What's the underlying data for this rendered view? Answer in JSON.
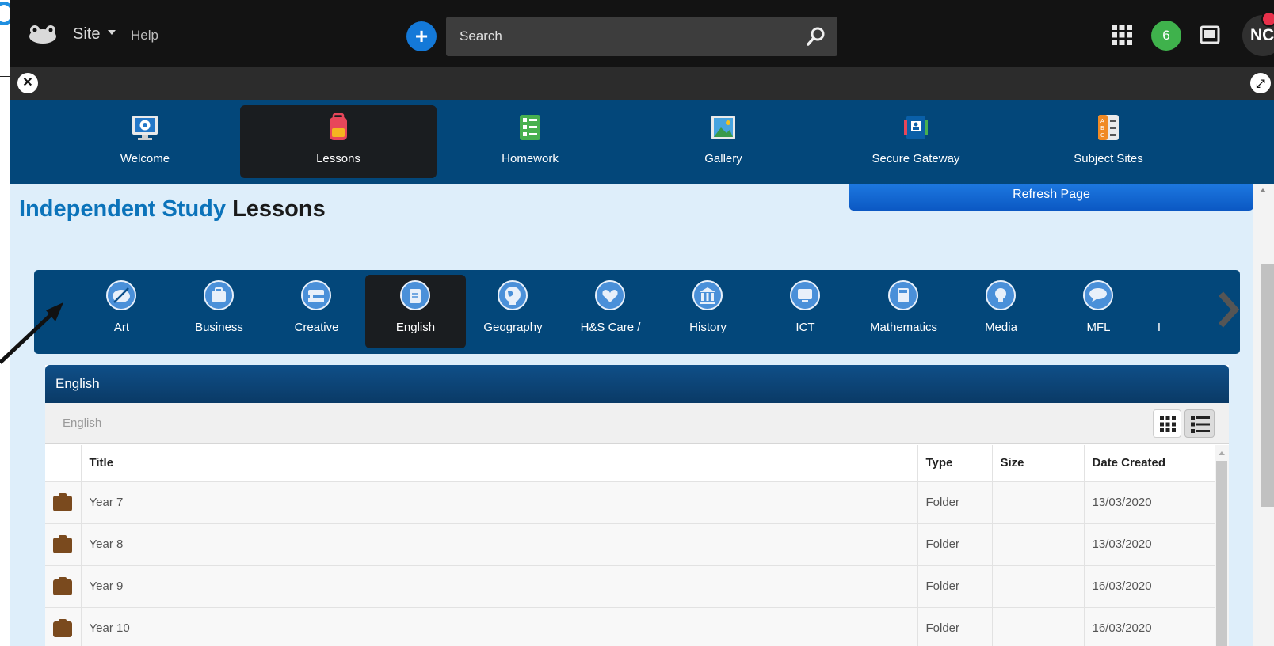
{
  "topbar": {
    "site_label": "Site",
    "help_label": "Help",
    "search_placeholder": "Search",
    "notification_count": "6",
    "user_initials": "NC"
  },
  "appnav": {
    "items": [
      {
        "label": "Welcome",
        "icon": "monitor-lifebuoy-icon",
        "active": false
      },
      {
        "label": "Lessons",
        "icon": "backpack-icon",
        "active": true
      },
      {
        "label": "Homework",
        "icon": "checklist-icon",
        "active": false
      },
      {
        "label": "Gallery",
        "icon": "picture-icon",
        "active": false
      },
      {
        "label": "Secure Gateway",
        "icon": "id-badge-icon",
        "active": false
      },
      {
        "label": "Subject Sites",
        "icon": "abc-list-icon",
        "active": false
      }
    ]
  },
  "page": {
    "title_accent": "Independent Study",
    "title_rest": "Lessons",
    "refresh_label": "Refresh Page"
  },
  "subjects": {
    "items": [
      {
        "label": "Art",
        "icon": "palette-icon",
        "active": false
      },
      {
        "label": "Business",
        "icon": "briefcase-icon",
        "active": false
      },
      {
        "label": "Creative",
        "icon": "sewing-machine-icon",
        "active": false
      },
      {
        "label": "English",
        "icon": "quill-icon",
        "active": true
      },
      {
        "label": "Geography",
        "icon": "globe-icon",
        "active": false
      },
      {
        "label": "H&S Care /",
        "icon": "heart-hands-icon",
        "active": false
      },
      {
        "label": "History",
        "icon": "museum-icon",
        "active": false
      },
      {
        "label": "ICT",
        "icon": "computer-icon",
        "active": false
      },
      {
        "label": "Mathematics",
        "icon": "calculator-icon",
        "active": false
      },
      {
        "label": "Media",
        "icon": "lightbulb-icon",
        "active": false
      },
      {
        "label": "MFL",
        "icon": "speech-bubble-icon",
        "active": false
      },
      {
        "label": "I",
        "icon": "",
        "active": false
      }
    ]
  },
  "panel": {
    "header": "English",
    "breadcrumb": "English",
    "columns": [
      "Title",
      "Type",
      "Size",
      "Date Created"
    ],
    "rows": [
      {
        "title": "Year 7",
        "type": "Folder",
        "size": "",
        "date": "13/03/2020"
      },
      {
        "title": "Year 8",
        "type": "Folder",
        "size": "",
        "date": "13/03/2020"
      },
      {
        "title": "Year 9",
        "type": "Folder",
        "size": "",
        "date": "16/03/2020"
      },
      {
        "title": "Year 10",
        "type": "Folder",
        "size": "",
        "date": "16/03/2020"
      }
    ]
  },
  "colors": {
    "nav_blue": "#03477a",
    "active_dark": "#1a1d20",
    "accent_blue": "#0b73ba",
    "content_bg": "#deeefa",
    "folder_brown": "#7a4a1e",
    "badge_green": "#3fb24c"
  }
}
